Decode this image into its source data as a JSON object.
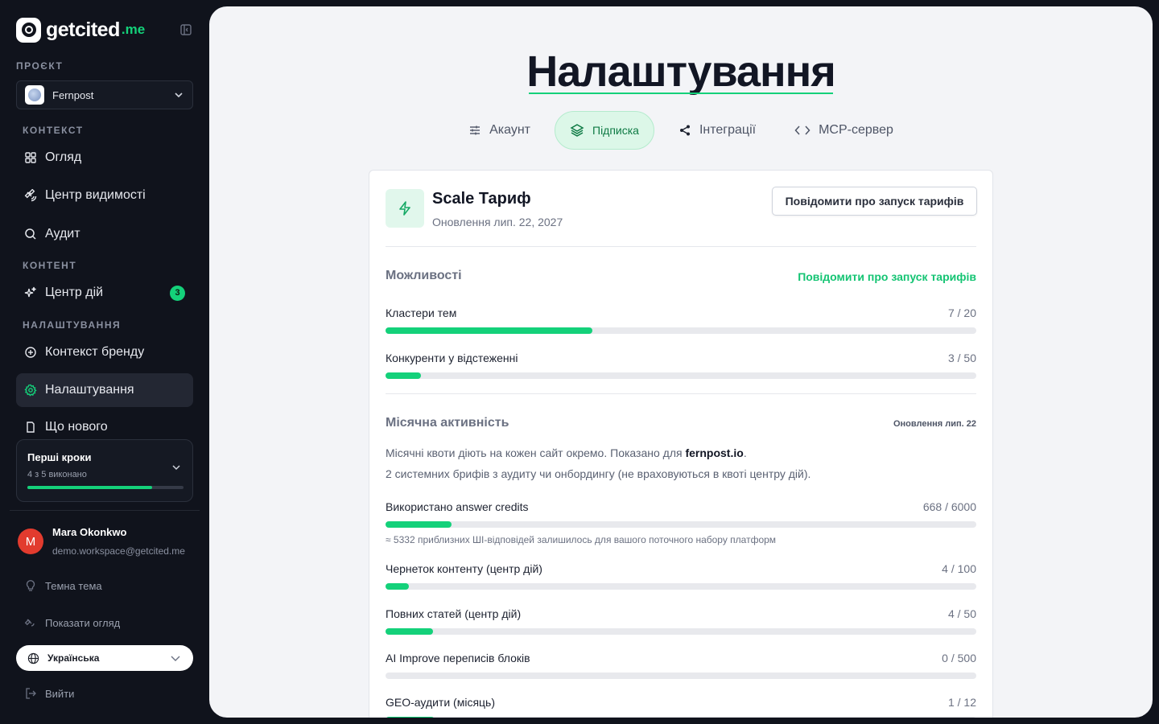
{
  "brand": {
    "name": "getcited",
    "tld": ".me"
  },
  "sidebar": {
    "project_label": "ПРОЄКТ",
    "project_name": "Fernpost",
    "context_label": "КОНТЕКСТ",
    "content_label": "КОНТЕНТ",
    "settings_label": "НАЛАШТУВАННЯ",
    "items": [
      {
        "label": "Огляд",
        "icon": "grid-icon"
      },
      {
        "label": "Центр видимості",
        "icon": "satellite-icon"
      },
      {
        "label": "Аудит",
        "icon": "search-icon"
      },
      {
        "label": "Центр дій",
        "icon": "sparkles-icon",
        "badge": "3"
      },
      {
        "label": "Контекст бренду",
        "icon": "plus-circle-icon"
      },
      {
        "label": "Налаштування",
        "icon": "gear-icon",
        "active": true
      },
      {
        "label": "Що нового",
        "icon": "file-icon"
      }
    ],
    "steps": {
      "title": "Перші кроки",
      "subtitle": "4 з 5 виконано",
      "progress": 0.8
    },
    "user": {
      "initial": "M",
      "name": "Mara Okonkwo",
      "email": "demo.workspace@getcited.me"
    },
    "theme_label": "Темна тема",
    "tour_label": "Показати огляд",
    "language": "Українська",
    "logout_label": "Вийти"
  },
  "page": {
    "title": "Налаштування",
    "tabs": [
      {
        "label": "Акаунт",
        "icon": "sliders-icon"
      },
      {
        "label": "Підписка",
        "icon": "layers-icon",
        "active": true
      },
      {
        "label": "Інтеграції",
        "icon": "share-icon"
      },
      {
        "label": "MCP-сервер",
        "icon": "code-icon"
      }
    ]
  },
  "plan": {
    "name": "Scale Тариф",
    "updated": "Оновлення лип. 22, 2027",
    "notify_button": "Повідомити про запуск тарифів"
  },
  "features": {
    "title": "Можливості",
    "link": "Повідомити про запуск тарифів",
    "items": [
      {
        "label": "Кластери тем",
        "value": "7 / 20",
        "used": 7,
        "limit": 20
      },
      {
        "label": "Конкуренти у відстеженні",
        "value": "3 / 50",
        "used": 3,
        "limit": 50
      }
    ]
  },
  "monthly": {
    "title": "Місячна активність",
    "meta": "Оновлення лип. 22",
    "note_prefix": "Місячні квоти діють на кожен сайт окремо. Показано для ",
    "note_site": "fernpost.io",
    "note_suffix": ".",
    "note2": "2 системних брифів з аудиту чи онбордингу (не враховуються в квоті центру дій).",
    "items": [
      {
        "label": "Використано answer credits",
        "value": "668 / 6000",
        "used": 668,
        "limit": 6000,
        "note": "≈ 5332 приблизних ШІ-відповідей залишилось для вашого поточного набору платформ"
      },
      {
        "label": "Чернеток контенту (центр дій)",
        "value": "4 / 100",
        "used": 4,
        "limit": 100
      },
      {
        "label": "Повних статей (центр дій)",
        "value": "4 / 50",
        "used": 4,
        "limit": 50
      },
      {
        "label": "AI Improve переписів блоків",
        "value": "0 / 500",
        "used": 0,
        "limit": 500
      },
      {
        "label": "GEO-аудити (місяць)",
        "value": "1 / 12",
        "used": 1,
        "limit": 12
      }
    ]
  },
  "colors": {
    "accent": "#14d17a",
    "sidebar_bg": "#10131c",
    "main_bg": "#f3f4f7"
  }
}
